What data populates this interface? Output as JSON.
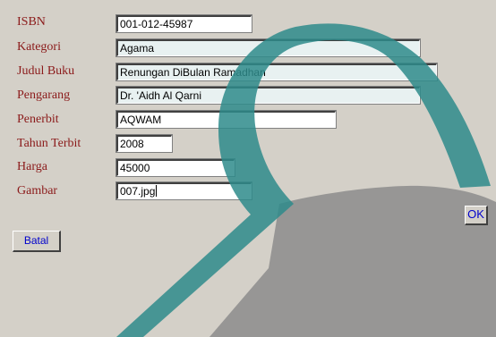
{
  "form": {
    "fields": [
      {
        "label": "ISBN",
        "value": "001-012-45987"
      },
      {
        "label": "Kategori",
        "value": "Agama"
      },
      {
        "label": "Judul Buku",
        "value": "Renungan DiBulan Ramadhan"
      },
      {
        "label": "Pengarang",
        "value": "Dr. 'Aidh Al Qarni"
      },
      {
        "label": "Penerbit",
        "value": "AQWAM"
      },
      {
        "label": "Tahun Terbit",
        "value": "2008"
      },
      {
        "label": "Harga",
        "value": "45000"
      },
      {
        "label": "Gambar",
        "value": "007.jpg"
      }
    ],
    "ok_label": "OK",
    "cancel_label": "Batal"
  },
  "colors": {
    "background": "#d4d0c8",
    "label_text": "#8b1a1a",
    "button_text": "#0000cc",
    "watermark_teal": "#2e8b8b",
    "watermark_gray": "#8c8c8c"
  }
}
